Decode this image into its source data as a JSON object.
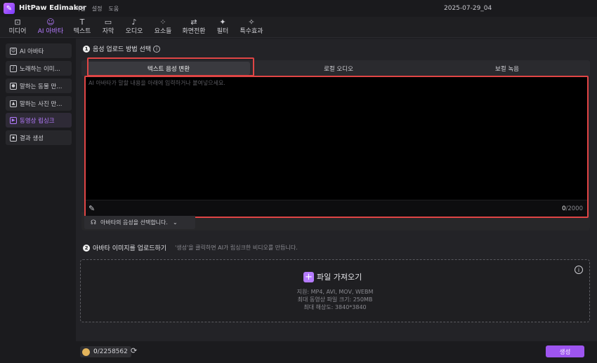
{
  "app": {
    "title": "HitPaw Edimakor",
    "doc_title": "2025-07-29_04"
  },
  "menu": [
    "파일",
    "설정",
    "도움"
  ],
  "toolbar": [
    {
      "label": "미디어",
      "icon": "media-icon"
    },
    {
      "label": "AI 아바타",
      "icon": "avatar-icon",
      "active": true
    },
    {
      "label": "텍스트",
      "icon": "text-icon"
    },
    {
      "label": "자막",
      "icon": "subtitle-icon"
    },
    {
      "label": "오디오",
      "icon": "audio-icon"
    },
    {
      "label": "요소들",
      "icon": "elements-icon"
    },
    {
      "label": "화면전환",
      "icon": "transition-icon"
    },
    {
      "label": "필터",
      "icon": "filter-icon"
    },
    {
      "label": "특수효과",
      "icon": "effects-icon"
    }
  ],
  "sidebar": [
    {
      "label": "AI 아바타"
    },
    {
      "label": "노래하는 이미..."
    },
    {
      "label": "말하는 동물 만..."
    },
    {
      "label": "말하는 사진 만..."
    },
    {
      "label": "동영상 립싱크",
      "active": true
    },
    {
      "label": "결과 생성"
    }
  ],
  "step1": {
    "number": "1",
    "title": "음성 업로드 방법 선택"
  },
  "tabs": [
    "텍스트 음성 변환",
    "로컬 오디오",
    "보컬 녹음"
  ],
  "textbox": {
    "placeholder": "AI 아바타가 말할 내용을 아래에 입력하거나 붙여넣으세요.",
    "count": "0",
    "max": "/2000"
  },
  "voice_select": {
    "label": "아바타의 음성을 선택합니다."
  },
  "step2": {
    "number": "2",
    "title": "아바타 이미지를 업로드하기",
    "hint": "'생성'을 클릭하면 AI가 립싱크한 비디오를 만듭니다."
  },
  "dropzone": {
    "button_label": "파일 가져오기",
    "support": "지원: MP4, AVI, MOV, WEBM",
    "max_size": "최대 동영상 파일 크기: 250MB",
    "max_res": "최대 해상도: 3840*3840"
  },
  "credits": {
    "value": "0",
    "total": "/2258562"
  },
  "generate_label": "생성",
  "colors": {
    "accent": "#b57bff",
    "highlight": "#e04545",
    "button": "#9e55f0"
  }
}
